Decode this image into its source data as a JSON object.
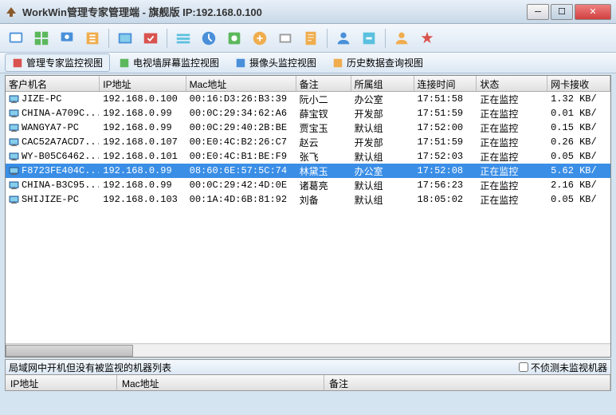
{
  "title": "WorkWin管理专家管理端 - 旗舰版 IP:192.168.0.100",
  "viewtabs": [
    {
      "label": "管理专家监控视图",
      "active": true
    },
    {
      "label": "电视墙屏幕监控视图",
      "active": false
    },
    {
      "label": "摄像头监控视图",
      "active": false
    },
    {
      "label": "历史数据查询视图",
      "active": false
    }
  ],
  "columns": [
    "客户机名",
    "IP地址",
    "Mac地址",
    "备注",
    "所属组",
    "连接时间",
    "状态",
    "网卡接收"
  ],
  "rows": [
    {
      "name": "JIZE-PC",
      "ip": "192.168.0.100",
      "mac": "00:16:D3:26:B3:39",
      "note": "阮小二",
      "group": "办公室",
      "time": "17:51:58",
      "status": "正在监控",
      "rx": "1.32 KB/",
      "sel": false
    },
    {
      "name": "CHINA-A709C...",
      "ip": "192.168.0.99",
      "mac": "00:0C:29:34:62:A6",
      "note": "薛宝钗",
      "group": "开发部",
      "time": "17:51:59",
      "status": "正在监控",
      "rx": "0.01 KB/",
      "sel": false
    },
    {
      "name": "WANGYA7-PC",
      "ip": "192.168.0.99",
      "mac": "00:0C:29:40:2B:BE",
      "note": "贾宝玉",
      "group": "默认组",
      "time": "17:52:00",
      "status": "正在监控",
      "rx": "0.15 KB/",
      "sel": false
    },
    {
      "name": "CAC52A7ACD7...",
      "ip": "192.168.0.107",
      "mac": "00:E0:4C:B2:26:C7",
      "note": "赵云",
      "group": "开发部",
      "time": "17:51:59",
      "status": "正在监控",
      "rx": "0.26 KB/",
      "sel": false
    },
    {
      "name": "WY-B05C6462...",
      "ip": "192.168.0.101",
      "mac": "00:E0:4C:B1:BE:F9",
      "note": "张飞",
      "group": "默认组",
      "time": "17:52:03",
      "status": "正在监控",
      "rx": "0.05 KB/",
      "sel": false
    },
    {
      "name": "F8723FE404C...",
      "ip": "192.168.0.99",
      "mac": "08:60:6E:57:5C:74",
      "note": "林黛玉",
      "group": "办公室",
      "time": "17:52:08",
      "status": "正在监控",
      "rx": "5.62 KB/",
      "sel": true
    },
    {
      "name": "CHINA-B3C95...",
      "ip": "192.168.0.99",
      "mac": "00:0C:29:42:4D:0E",
      "note": "诸葛亮",
      "group": "默认组",
      "time": "17:56:23",
      "status": "正在监控",
      "rx": "2.16 KB/",
      "sel": false
    },
    {
      "name": "SHIJIZE-PC",
      "ip": "192.168.0.103",
      "mac": "00:1A:4D:6B:81:92",
      "note": "刘备",
      "group": "默认组",
      "time": "18:05:02",
      "status": "正在监控",
      "rx": "0.05 KB/",
      "sel": false
    }
  ],
  "bottom": {
    "label": "局域网中开机但没有被监视的机器列表",
    "checkbox": "不侦测未监视机器",
    "cols": [
      "IP地址",
      "Mac地址",
      "备注"
    ]
  }
}
